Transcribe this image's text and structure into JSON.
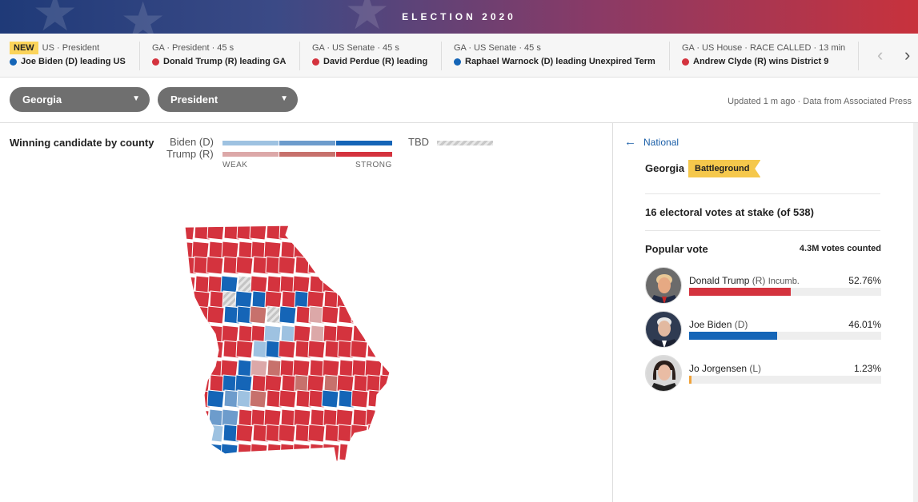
{
  "banner": {
    "title": "ELECTION 2020"
  },
  "ticker": [
    {
      "badge": "NEW",
      "meta": "US · President",
      "headline": "Joe Biden (D) leading US",
      "party": "blue"
    },
    {
      "meta": "GA · President · 45 s",
      "headline": "Donald Trump (R) leading GA",
      "party": "red"
    },
    {
      "meta": "GA · US Senate · 45 s",
      "headline": "David Perdue (R) leading",
      "party": "red"
    },
    {
      "meta": "GA · US Senate · 45 s",
      "headline": "Raphael Warnock (D) leading Unexpired Term",
      "party": "blue"
    },
    {
      "meta": "GA · US House · RACE CALLED · 13 min",
      "headline": "Andrew Clyde (R) wins District 9",
      "party": "red"
    }
  ],
  "ticker_nav": {
    "prev": "‹",
    "next": "›"
  },
  "selectors": {
    "state": "Georgia",
    "race": "President"
  },
  "updated": "Updated 1 m ago  ·  Data from Associated Press",
  "legend": {
    "title": "Winning candidate by county",
    "biden": "Biden (D)",
    "trump": "Trump (R)",
    "weak": "WEAK",
    "strong": "STRONG",
    "tbd": "TBD",
    "colors": {
      "biden": [
        "#9ec2e1",
        "#6d9ccc",
        "#1565b7"
      ],
      "trump": [
        "#dca8a8",
        "#c7716c",
        "#d4333e"
      ]
    }
  },
  "panel": {
    "back": "National",
    "state": "Georgia",
    "badge": "Battleground",
    "electoral": "16 electoral votes at stake (of 538)",
    "popular_vote": "Popular vote",
    "counted": "4.3M votes counted",
    "candidates": [
      {
        "name": "Donald Trump",
        "party": "(R)",
        "note": "Incumb.",
        "percent": "52.76%",
        "share": 52.76,
        "color": "#d4333e"
      },
      {
        "name": "Joe Biden",
        "party": "(D)",
        "note": "",
        "percent": "46.01%",
        "share": 46.01,
        "color": "#1565b7"
      },
      {
        "name": "Jo Jorgensen",
        "party": "(L)",
        "note": "",
        "percent": "1.23%",
        "share": 1.23,
        "color": "#f0a33a"
      }
    ]
  }
}
